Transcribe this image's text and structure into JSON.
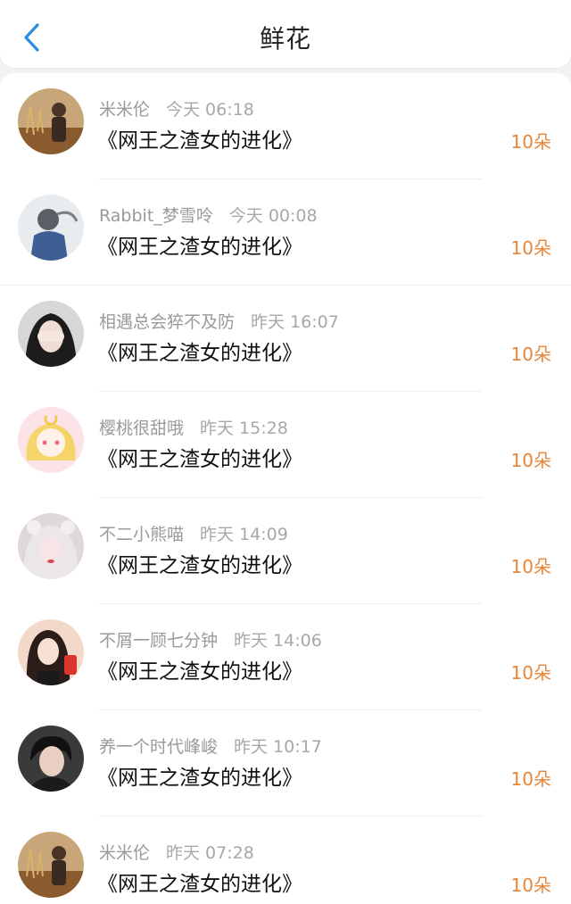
{
  "header": {
    "title": "鲜花",
    "back_icon": "chevron-left-icon"
  },
  "colors": {
    "accent": "#e88536",
    "back": "#2a8de0"
  },
  "items": [
    {
      "name": "米米伦",
      "time": "今天 06:18",
      "book": "《网王之渣女的进化》",
      "amount": "10朵"
    },
    {
      "name": "Rabbit_梦雪呤",
      "time": "今天 00:08",
      "book": "《网王之渣女的进化》",
      "amount": "10朵"
    },
    {
      "name": "相遇总会猝不及防",
      "time": "昨天 16:07",
      "book": "《网王之渣女的进化》",
      "amount": "10朵"
    },
    {
      "name": "樱桃很甜哦",
      "time": "昨天 15:28",
      "book": "《网王之渣女的进化》",
      "amount": "10朵"
    },
    {
      "name": "不二小熊喵",
      "time": "昨天 14:09",
      "book": "《网王之渣女的进化》",
      "amount": "10朵"
    },
    {
      "name": "不屑一顾七分钟",
      "time": "昨天 14:06",
      "book": "《网王之渣女的进化》",
      "amount": "10朵"
    },
    {
      "name": "养一个时代峰峻",
      "time": "昨天 10:17",
      "book": "《网王之渣女的进化》",
      "amount": "10朵"
    },
    {
      "name": "米米伦",
      "time": "昨天 07:28",
      "book": "《网王之渣女的进化》",
      "amount": "10朵"
    }
  ]
}
